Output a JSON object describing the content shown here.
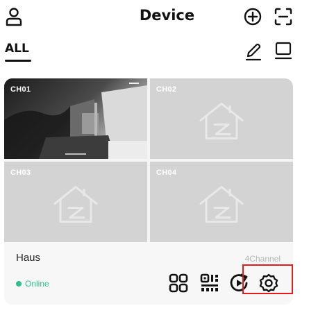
{
  "header": {
    "title": "Device",
    "icons": [
      "user-icon",
      "add-circle-icon",
      "scan-icon"
    ]
  },
  "tabs": {
    "active": "ALL",
    "icons": [
      "edit-icon",
      "layout-icon"
    ]
  },
  "device": {
    "name": "Haus",
    "channel_count": "4Channel",
    "status": "Online",
    "status_color": "#2fbf8a",
    "channels": [
      {
        "label": "CH01",
        "has_feed": true
      },
      {
        "label": "CH02",
        "has_feed": false
      },
      {
        "label": "CH03",
        "has_feed": false
      },
      {
        "label": "CH04",
        "has_feed": false
      }
    ],
    "actions": [
      "grid-view-icon",
      "qr-code-icon",
      "playback-icon",
      "settings-icon"
    ]
  },
  "highlight_color": "#e41b1b"
}
